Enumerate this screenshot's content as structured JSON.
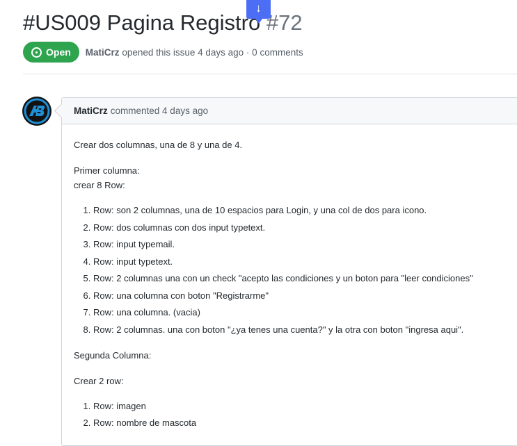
{
  "issue": {
    "title": "#US009 Pagina Registro",
    "number": "#72",
    "state_label": "Open",
    "author": "MatiCrz",
    "opened_text": "opened this issue 4 days ago · 0 comments"
  },
  "jump_icon": "arrow-down-icon",
  "comment": {
    "author": "MatiCrz",
    "meta": "commented 4 days ago",
    "intro": "Crear dos columnas, una de 8 y una de 4.",
    "col1_heading": "Primer columna:",
    "col1_sub": "crear 8 Row:",
    "col1_items": [
      "Row: son 2 columnas, una de 10 espacios para Login, y una col de dos para icono.",
      "Row: dos columnas con dos input typetext.",
      "Row: input typemail.",
      "Row: input typetext.",
      "Row: 2 columnas una con un check \"acepto las condiciones y un boton para \"leer condiciones\"",
      "Row: una columna con boton \"Registrarme\"",
      "Row: una columna. (vacia)",
      "Row: 2 columnas. una con boton \"¿ya tenes una cuenta?\" y la otra con boton \"ingresa aqui\"."
    ],
    "col2_heading": "Segunda Columna:",
    "col2_sub": "Crear 2 row:",
    "col2_items": [
      "Row: imagen",
      "Row: nombre de mascota"
    ]
  },
  "colors": {
    "open_green": "#2ea44f",
    "jump_blue": "#4c6ef5",
    "avatar_ring": "#1f8fd6"
  }
}
